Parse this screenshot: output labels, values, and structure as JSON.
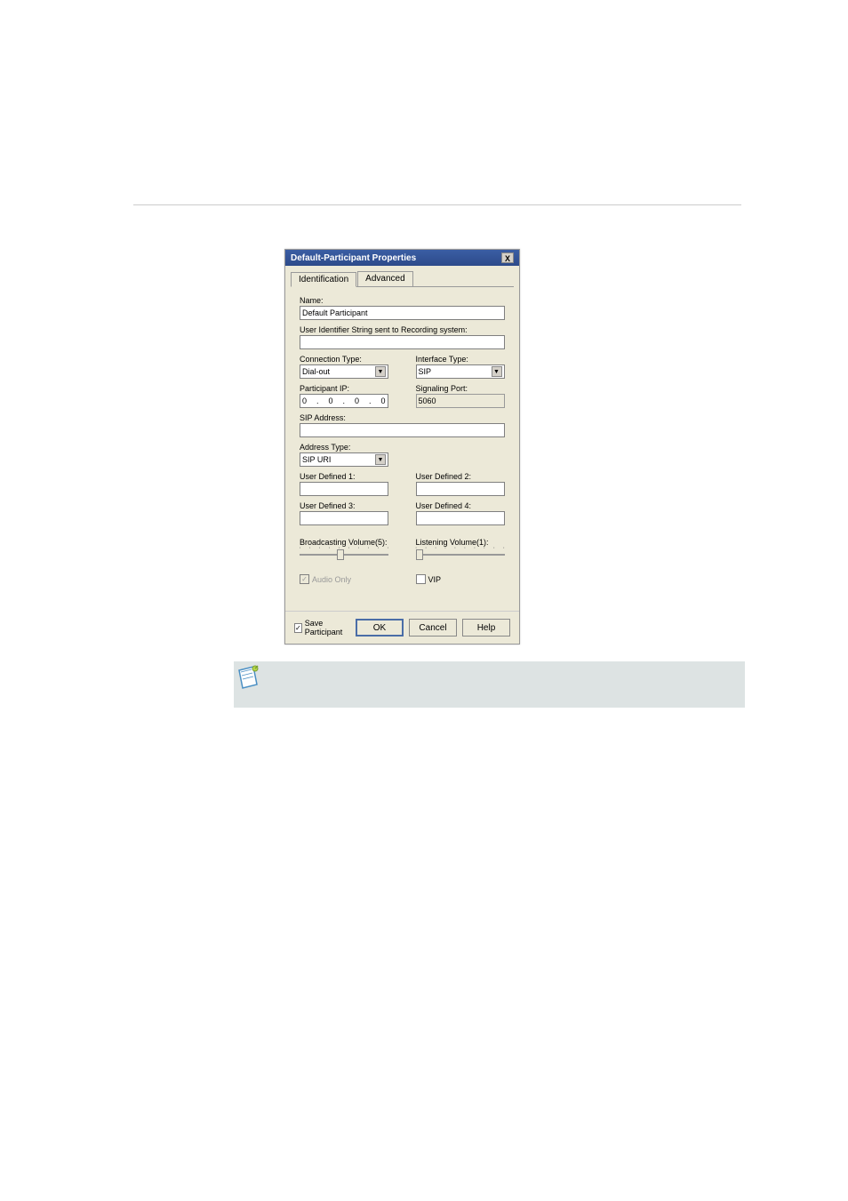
{
  "dialog": {
    "title": "Default-Participant Properties",
    "close_x": "X",
    "tabs": {
      "identification": "Identification",
      "advanced": "Advanced"
    },
    "fields": {
      "name_label": "Name:",
      "name_value": "Default Participant",
      "uid_label": "User Identifier String sent to Recording system:",
      "uid_value": "",
      "connection_type_label": "Connection Type:",
      "connection_type_value": "Dial-out",
      "interface_type_label": "Interface Type:",
      "interface_type_value": "SIP",
      "participant_ip_label": "Participant IP:",
      "participant_ip_value": "0  .  0  .  0  .  0",
      "signaling_port_label": "Signaling Port:",
      "signaling_port_value": "5060",
      "sip_address_label": "SIP Address:",
      "sip_address_value": "",
      "address_type_label": "Address Type:",
      "address_type_value": "SIP URI",
      "ud1_label": "User Defined 1:",
      "ud1_value": "",
      "ud2_label": "User Defined 2:",
      "ud2_value": "",
      "ud3_label": "User Defined 3:",
      "ud3_value": "",
      "ud4_label": "User Defined 4:",
      "ud4_value": "",
      "broadcasting_label": "Broadcasting Volume(5):",
      "listening_label": "Listening Volume(1):",
      "audio_only_label": "Audio Only",
      "vip_label": "VIP"
    },
    "footer": {
      "save_participant_label": "Save Participant",
      "ok": "OK",
      "cancel": "Cancel",
      "help": "Help"
    }
  },
  "slider_ticks": [
    "1",
    "",
    "",
    "",
    "",
    "",
    "",
    "",
    "",
    "10"
  ]
}
